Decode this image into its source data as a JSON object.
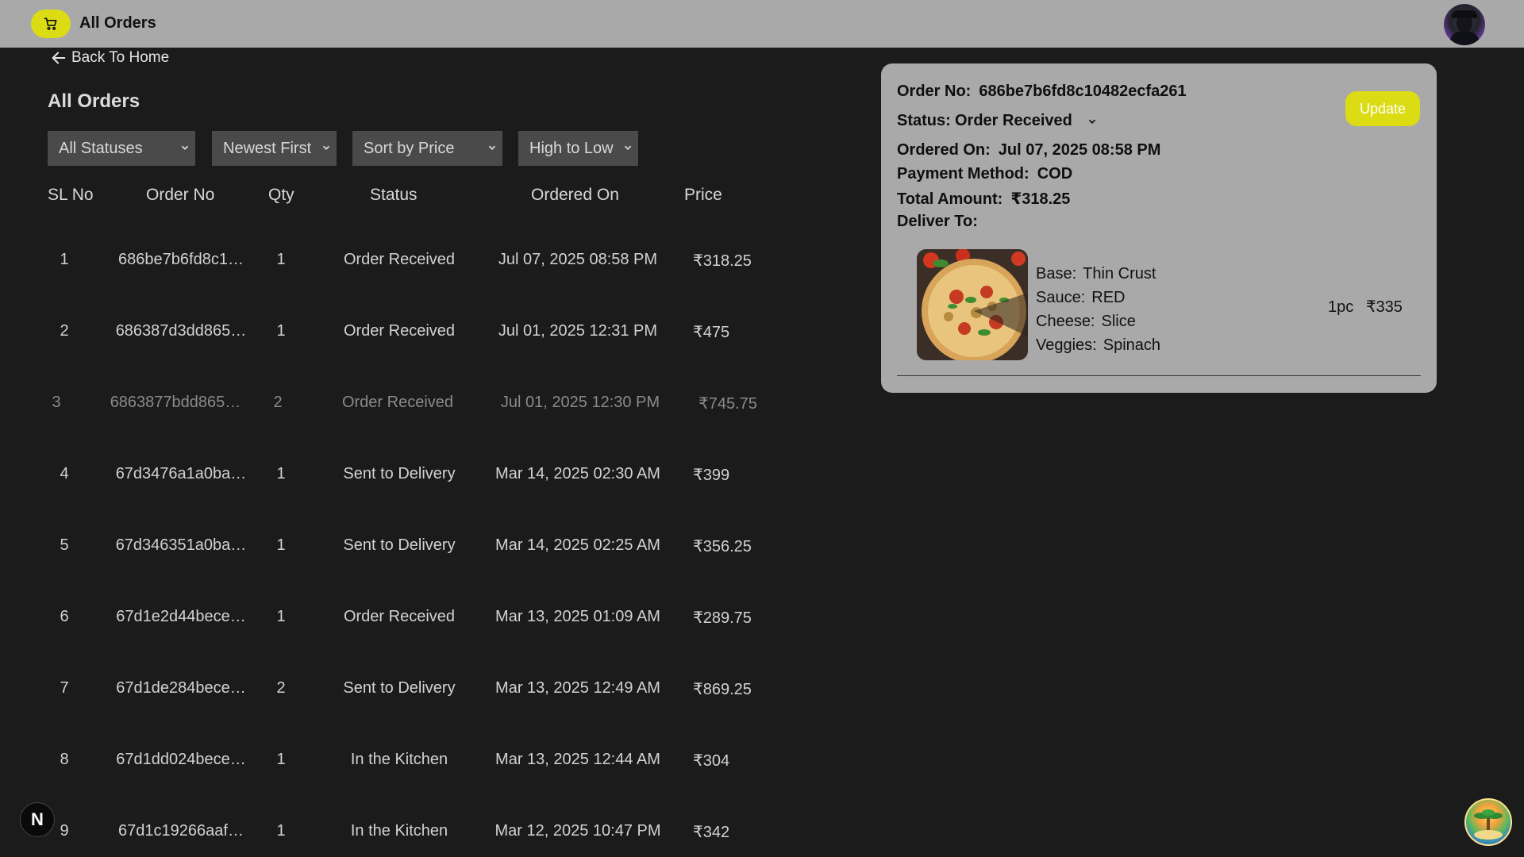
{
  "header": {
    "title": "All Orders",
    "cart_icon": "cart-icon",
    "avatar_icon": "user-avatar"
  },
  "nav": {
    "back_label": "Back To Home"
  },
  "page": {
    "title": "All Orders"
  },
  "filters": {
    "status": "All Statuses",
    "order": "Newest First",
    "sort_by": "Sort by Price",
    "direction": "High to Low"
  },
  "table": {
    "headers": [
      "SL No",
      "Order No",
      "Qty",
      "Status",
      "Ordered On",
      "Price"
    ],
    "rows": [
      {
        "sl": "1",
        "order_no": "686be7b6fd8c1…",
        "qty": "1",
        "status": "Order Received",
        "ordered_on": "Jul 07, 2025 08:58 PM",
        "price": "₹318.25"
      },
      {
        "sl": "2",
        "order_no": "686387d3dd865…",
        "qty": "1",
        "status": "Order Received",
        "ordered_on": "Jul 01, 2025 12:31 PM",
        "price": "₹475"
      },
      {
        "sl": "3",
        "order_no": "6863877bdd865…",
        "qty": "2",
        "status": "Order Received",
        "ordered_on": "Jul 01, 2025 12:30 PM",
        "price": "₹745.75"
      },
      {
        "sl": "4",
        "order_no": "67d3476a1a0ba…",
        "qty": "1",
        "status": "Sent to Delivery",
        "ordered_on": "Mar 14, 2025 02:30 AM",
        "price": "₹399"
      },
      {
        "sl": "5",
        "order_no": "67d346351a0ba…",
        "qty": "1",
        "status": "Sent to Delivery",
        "ordered_on": "Mar 14, 2025 02:25 AM",
        "price": "₹356.25"
      },
      {
        "sl": "6",
        "order_no": "67d1e2d44bece…",
        "qty": "1",
        "status": "Order Received",
        "ordered_on": "Mar 13, 2025 01:09 AM",
        "price": "₹289.75"
      },
      {
        "sl": "7",
        "order_no": "67d1de284bece…",
        "qty": "2",
        "status": "Sent to Delivery",
        "ordered_on": "Mar 13, 2025 12:49 AM",
        "price": "₹869.25"
      },
      {
        "sl": "8",
        "order_no": "67d1dd024bece…",
        "qty": "1",
        "status": "In the Kitchen",
        "ordered_on": "Mar 13, 2025 12:44 AM",
        "price": "₹304"
      },
      {
        "sl": "9",
        "order_no": "67d1c19266aaf…",
        "qty": "1",
        "status": "In the Kitchen",
        "ordered_on": "Mar 12, 2025 10:47 PM",
        "price": "₹342"
      }
    ]
  },
  "detail": {
    "order_no_label": "Order No:",
    "order_no": "686be7b6fd8c10482ecfa261",
    "status_label": "Status:",
    "status": "Order Received",
    "ordered_on_label": "Ordered On:",
    "ordered_on": "Jul 07, 2025 08:58 PM",
    "payment_label": "Payment Method:",
    "payment": "COD",
    "total_label": "Total Amount:",
    "total": "₹318.25",
    "deliver_label": "Deliver To:",
    "update_label": "Update",
    "item": {
      "base_label": "Base:",
      "base": "Thin Crust",
      "sauce_label": "Sauce:",
      "sauce": "RED",
      "cheese_label": "Cheese:",
      "cheese": "Slice",
      "veggies_label": "Veggies:",
      "veggies": "Spinach",
      "qty": "1pc",
      "price": "₹335"
    }
  },
  "floating": {
    "next_badge": "N"
  },
  "colors": {
    "background": "#1b1b1b",
    "topbar": "#a9a9a9",
    "accent": "#dcdc14",
    "card": "#a9a9a9"
  }
}
